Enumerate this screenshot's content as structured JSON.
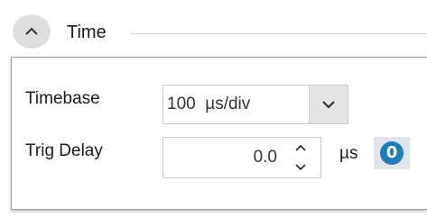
{
  "section": {
    "title": "Time",
    "collapse_icon": "chevron-up-icon"
  },
  "timebase": {
    "label": "Timebase",
    "value": "100  µs/div",
    "dropdown_icon": "chevron-down-icon"
  },
  "trig_delay": {
    "label": "Trig Delay",
    "value": "0.0",
    "unit": "µs",
    "up_icon": "chevron-up-icon",
    "down_icon": "chevron-down-icon",
    "zero_button": {
      "label": "0",
      "color": "#1b7fb9"
    }
  }
}
